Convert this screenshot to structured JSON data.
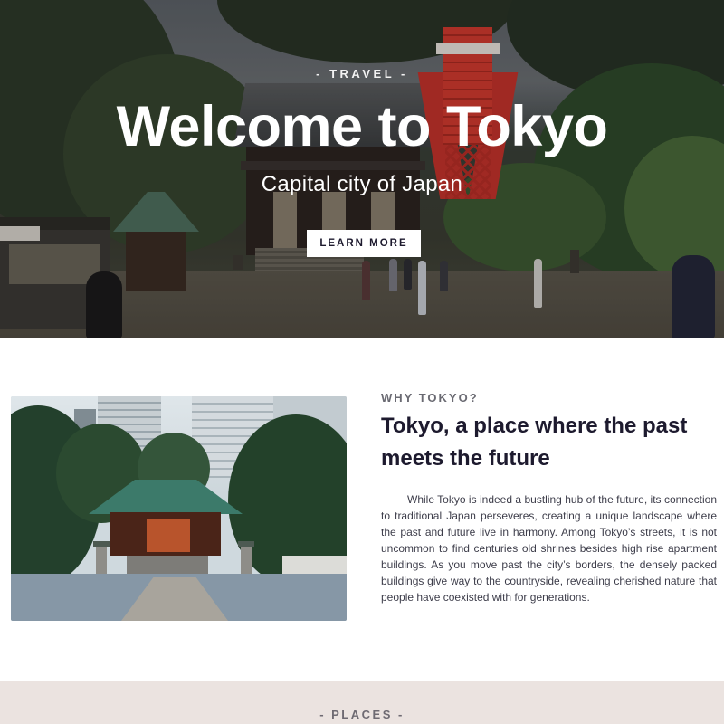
{
  "hero": {
    "eyebrow": "- TRAVEL -",
    "title": "Welcome to Tokyo",
    "subtitle": "Capital city of Japan",
    "button_label": "LEARN MORE"
  },
  "why": {
    "eyebrow": "WHY TOKYO?",
    "title": "Tokyo, a place where the past meets the future",
    "body": "While Tokyo is indeed a bustling hub of the future, its connection to traditional Japan perseveres, creating a unique landscape where the past and future live in harmony. Among Tokyo’s streets, it is not uncommon to find centuries old shrines besides high rise apartment buildings. As you move past the city’s borders, the densely packed buildings give way to the countryside, revealing cherished nature that people have coexisted with for generations."
  },
  "places": {
    "eyebrow": "- PLACES -"
  },
  "colors": {
    "text_dark": "#1d1a2e",
    "places_bg": "#ebe3e0",
    "button_bg": "#ffffff"
  }
}
